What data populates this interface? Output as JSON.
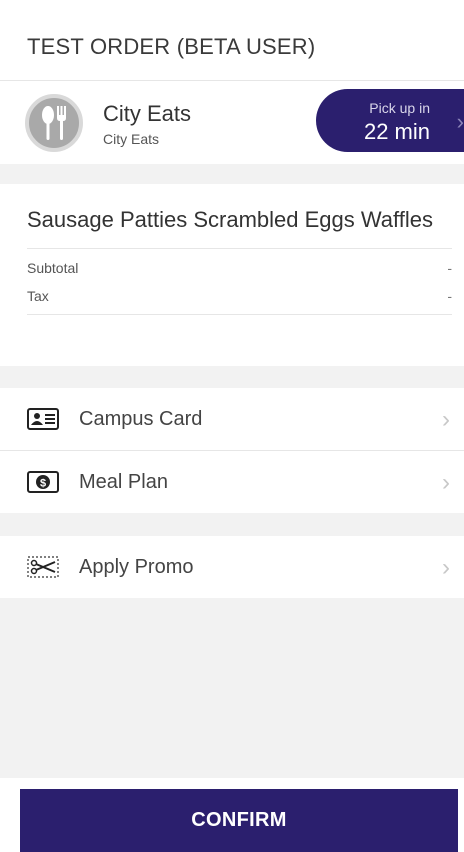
{
  "header": {
    "order_title": "TEST ORDER (BETA USER)"
  },
  "restaurant": {
    "name": "City Eats",
    "subtitle": "City Eats",
    "pickup_label": "Pick up in",
    "pickup_time": "22 min",
    "logo_icon": "fork-spoon-icon"
  },
  "order": {
    "items_title": "Sausage Patties Scrambled Eggs Waffles",
    "subtotal_label": "Subtotal",
    "subtotal_value": "-",
    "tax_label": "Tax",
    "tax_value": "-"
  },
  "payment": {
    "campus_card_label": "Campus Card",
    "meal_plan_label": "Meal Plan",
    "promo_label": "Apply Promo"
  },
  "actions": {
    "confirm_label": "CONFIRM"
  },
  "colors": {
    "accent": "#2b1f6e",
    "background": "#f2f2f2"
  }
}
